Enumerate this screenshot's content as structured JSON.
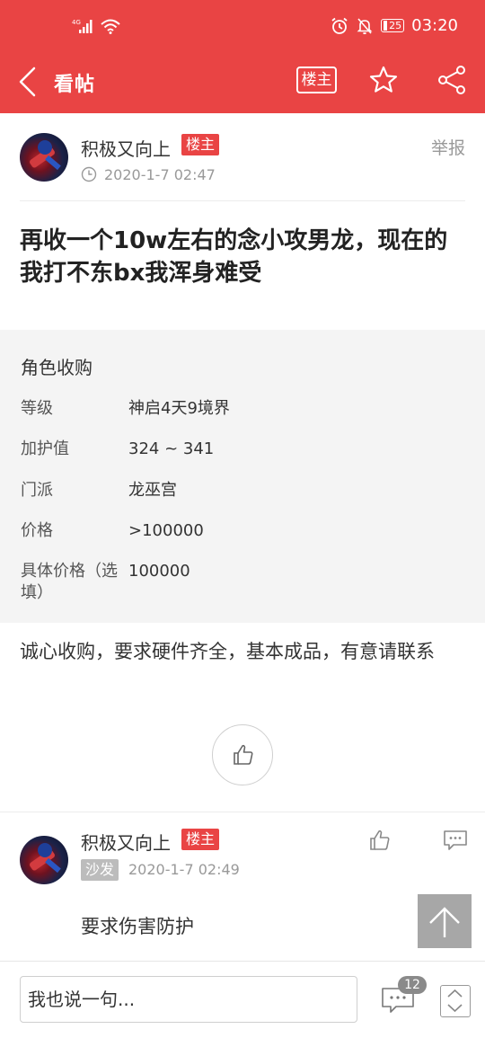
{
  "status_bar": {
    "signal_type": "4G",
    "battery_level": "25",
    "time": "03:20"
  },
  "header": {
    "title": "看帖",
    "owner_only_label": "楼主"
  },
  "post": {
    "author": "积极又向上",
    "owner_tag": "楼主",
    "time": "2020-1-7 02:47",
    "report_label": "举报",
    "title": "再收一个10w左右的念小攻男龙，现在的我打不东bx我浑身难受",
    "info": {
      "heading": "角色收购",
      "rows": [
        {
          "label": "等级",
          "value": "神启4天9境界"
        },
        {
          "label": "加护值",
          "value": "324 ~ 341"
        },
        {
          "label": "门派",
          "value": "龙巫宫"
        },
        {
          "label": "价格",
          "value": ">100000"
        },
        {
          "label": "具体价格（选填）",
          "value": "100000"
        }
      ]
    },
    "body": "诚心收购，要求硬件齐全，基本成品，有意请联系"
  },
  "reply": {
    "author": "积极又向上",
    "owner_tag": "楼主",
    "floor_tag": "沙发",
    "time": "2020-1-7 02:49",
    "content": "要求伤害防护"
  },
  "bottom_bar": {
    "input_placeholder": "我也说一句...",
    "comment_count": "12"
  },
  "colors": {
    "brand_red": "#e94444",
    "tag_gray": "#bcbcbc",
    "info_bg": "#f4f4f4"
  }
}
